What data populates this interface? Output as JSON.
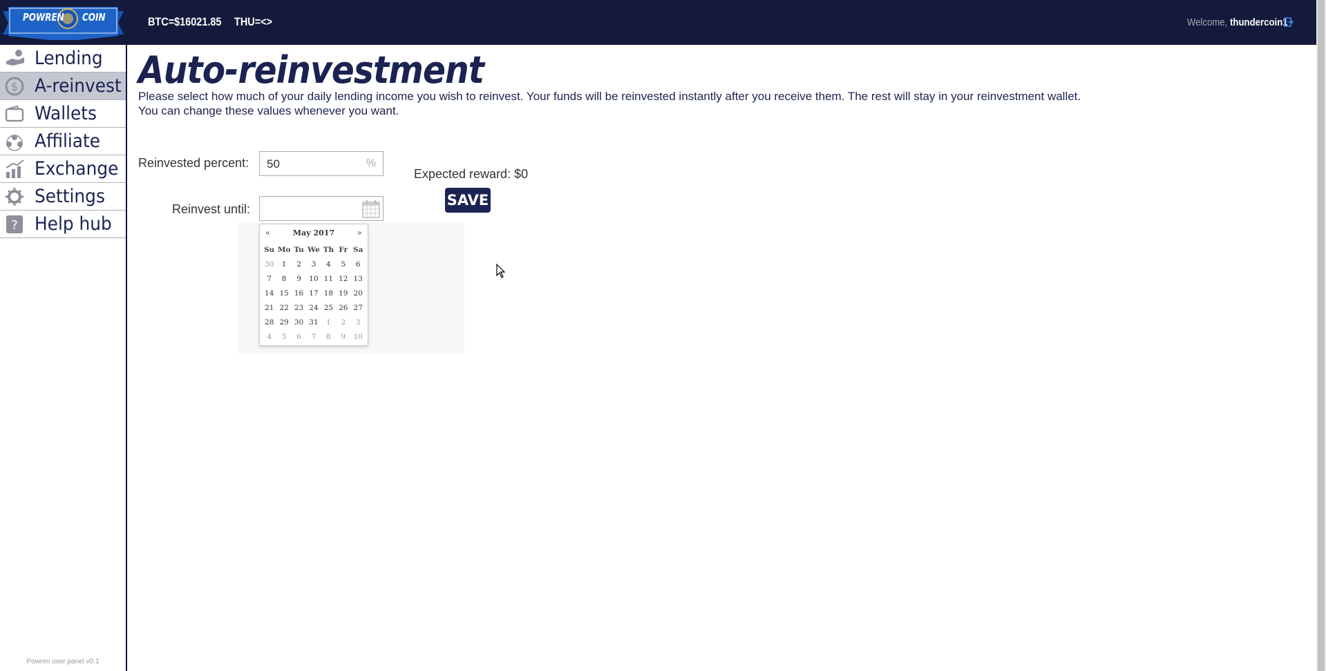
{
  "header": {
    "logo_left": "POWREN",
    "logo_right": "COIN",
    "btc_ticker": "BTC=$16021.85",
    "thu_ticker": "THU=<>",
    "welcome_prefix": "Welcome,",
    "username": "thundercoin1"
  },
  "sidebar": {
    "items": [
      {
        "label": "Lending",
        "icon": "hand-coin-icon",
        "active": false
      },
      {
        "label": "A-reinvest",
        "icon": "dollar-cycle-icon",
        "active": true
      },
      {
        "label": "Wallets",
        "icon": "wallet-icon",
        "active": false
      },
      {
        "label": "Affiliate",
        "icon": "people-network-icon",
        "active": false
      },
      {
        "label": "Exchange",
        "icon": "chart-up-icon",
        "active": false
      },
      {
        "label": "Settings",
        "icon": "gear-icon",
        "active": false
      },
      {
        "label": "Help hub",
        "icon": "question-icon",
        "active": false
      }
    ],
    "version": "Powren user panel v0.1"
  },
  "main": {
    "title": "Auto-reinvestment",
    "description_line1": "Please select how much of your daily lending income you wish to reinvest. Your funds will be reinvested instantly after you receive them. The rest will stay in your reinvestment wallet.",
    "description_line2": "You can change these values whenever you want.",
    "reinvested_percent_label": "Reinvested percent:",
    "reinvested_percent_value": "50",
    "percent_symbol": "%",
    "reinvest_until_label": "Reinvest until:",
    "reinvest_until_value": "",
    "expected_reward": "Expected reward: $0",
    "save_label": "SAVE"
  },
  "datepicker": {
    "prev": "«",
    "next": "»",
    "month": "May 2017",
    "weekdays": [
      "Su",
      "Mo",
      "Tu",
      "We",
      "Th",
      "Fr",
      "Sa"
    ],
    "weeks": [
      [
        "30",
        "1",
        "2",
        "3",
        "4",
        "5",
        "6"
      ],
      [
        "7",
        "8",
        "9",
        "10",
        "11",
        "12",
        "13"
      ],
      [
        "14",
        "15",
        "16",
        "17",
        "18",
        "19",
        "20"
      ],
      [
        "21",
        "22",
        "23",
        "24",
        "25",
        "26",
        "27"
      ],
      [
        "28",
        "29",
        "30",
        "31",
        "1",
        "2",
        "3"
      ],
      [
        "4",
        "5",
        "6",
        "7",
        "8",
        "9",
        "10"
      ]
    ],
    "muted": [
      [
        true,
        false,
        false,
        false,
        false,
        false,
        false
      ],
      [
        false,
        false,
        false,
        false,
        false,
        false,
        false
      ],
      [
        false,
        false,
        false,
        false,
        false,
        false,
        false
      ],
      [
        false,
        false,
        false,
        false,
        false,
        false,
        false
      ],
      [
        false,
        false,
        false,
        false,
        true,
        true,
        true
      ],
      [
        true,
        true,
        true,
        true,
        true,
        true,
        true
      ]
    ]
  },
  "colors": {
    "header_bg": "#141a3b",
    "brand_blue": "#1b2352",
    "active_nav_bg": "#c4c6d1",
    "ribbon_blue": "#1e64c8"
  }
}
